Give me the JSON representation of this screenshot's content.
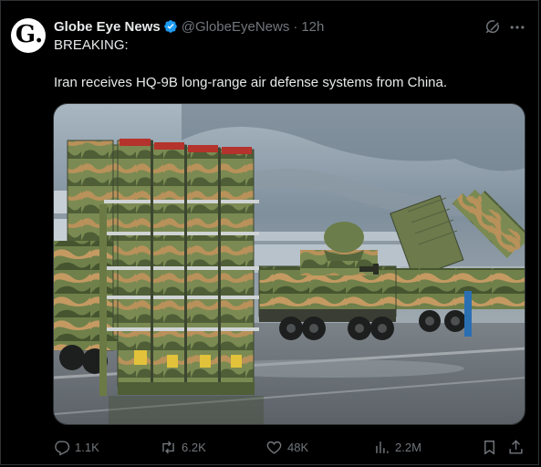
{
  "author": {
    "display_name": "Globe Eye News",
    "handle": "@GlobeEyeNews",
    "separator": "·",
    "timestamp": "12h",
    "avatar_letter": "G."
  },
  "tweet": {
    "line1": "BREAKING:",
    "line2": "Iran receives HQ-9B long-range air defense systems from China."
  },
  "actions": {
    "replies": "1.1K",
    "reposts": "6.2K",
    "likes": "48K",
    "views": "2.2M"
  },
  "colors": {
    "background": "#000000",
    "text_primary": "#e7e9ea",
    "text_secondary": "#71767b",
    "verified_blue": "#1d9bf0",
    "border": "#2f3336"
  },
  "icons": {
    "verified": "verified-badge-icon",
    "grok": "grok-icon",
    "more": "more-icon",
    "reply": "reply-icon",
    "repost": "repost-icon",
    "like": "heart-icon",
    "views": "views-icon",
    "bookmark": "bookmark-icon",
    "share": "share-icon"
  }
}
